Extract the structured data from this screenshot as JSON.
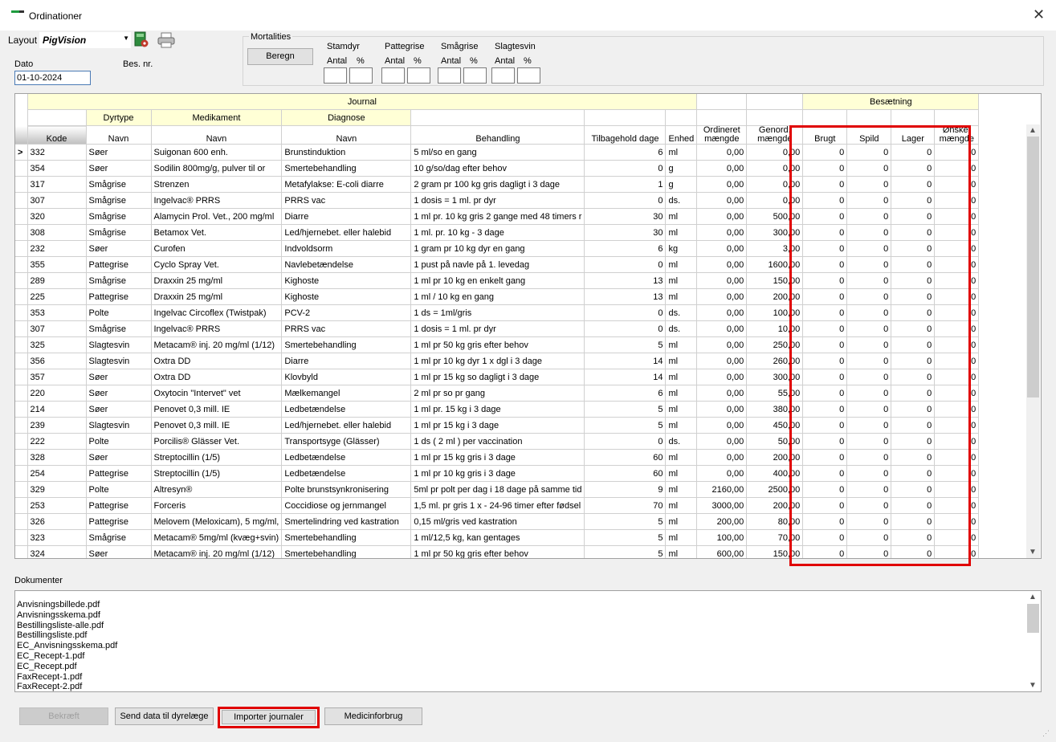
{
  "window": {
    "title": "Ordinationer",
    "close": "✕"
  },
  "layout": {
    "label": "Layout",
    "value": "PigVision"
  },
  "dato": {
    "label": "Dato",
    "value": "01-10-2024"
  },
  "besnr": {
    "label": "Bes. nr."
  },
  "mortalities": {
    "title": "Mortalities",
    "beregn": "Beregn",
    "groups": [
      {
        "name": "Stamdyr",
        "antal": "Antal",
        "pct": "%"
      },
      {
        "name": "Pattegrise",
        "antal": "Antal",
        "pct": "%"
      },
      {
        "name": "Smågrise",
        "antal": "Antal",
        "pct": "%"
      },
      {
        "name": "Slagtesvin",
        "antal": "Antal",
        "pct": "%"
      }
    ]
  },
  "grid": {
    "group_journal": "Journal",
    "group_besaetning": "Besætning",
    "sub_dyrtype": "Dyrtype",
    "sub_medikament": "Medikament",
    "sub_diagnose": "Diagnose",
    "columns": [
      "Kode",
      "Navn",
      "Navn",
      "Navn",
      "Behandling",
      "Tilbagehold dage",
      "Enhed",
      "Ordineret mængde",
      "Genord. mængde",
      "Brugt",
      "Spild",
      "Lager",
      "Ønsket mængde"
    ],
    "selected_marker": ">",
    "rows": [
      [
        "332",
        "Søer",
        "Suigonan 600 enh.",
        "Brunstinduktion",
        "5 ml/so en gang",
        "6",
        "ml",
        "0,00",
        "0,00",
        "0",
        "0",
        "0",
        "0"
      ],
      [
        "354",
        "Søer",
        "Sodilin 800mg/g, pulver til or",
        "Smertebehandling",
        "10 g/so/dag efter behov",
        "0",
        "g",
        "0,00",
        "0,00",
        "0",
        "0",
        "0",
        "0"
      ],
      [
        "317",
        "Smågrise",
        "Strenzen",
        "Metafylakse: E-coli diarre",
        "2 gram pr 100 kg gris dagligt i 3 dage",
        "1",
        "g",
        "0,00",
        "0,00",
        "0",
        "0",
        "0",
        "0"
      ],
      [
        "307",
        "Smågrise",
        "Ingelvac® PRRS",
        "PRRS vac",
        "1 dosis = 1 ml. pr dyr",
        "0",
        "ds.",
        "0,00",
        "0,00",
        "0",
        "0",
        "0",
        "0"
      ],
      [
        "320",
        "Smågrise",
        "Alamycin Prol. Vet., 200 mg/ml",
        "Diarre",
        "1 ml pr. 10 kg gris 2 gange med 48 timers r",
        "30",
        "ml",
        "0,00",
        "500,00",
        "0",
        "0",
        "0",
        "0"
      ],
      [
        "308",
        "Smågrise",
        "Betamox Vet.",
        "Led/hjernebet. eller halebid",
        "1 ml. pr. 10 kg - 3 dage",
        "30",
        "ml",
        "0,00",
        "300,00",
        "0",
        "0",
        "0",
        "0"
      ],
      [
        "232",
        "Søer",
        "Curofen",
        "Indvoldsorm",
        "1 gram pr 10 kg dyr en gang",
        "6",
        "kg",
        "0,00",
        "3,00",
        "0",
        "0",
        "0",
        "0"
      ],
      [
        "355",
        "Pattegrise",
        "Cyclo Spray Vet.",
        "Navlebetændelse",
        "1 pust på navle på 1. levedag",
        "0",
        "ml",
        "0,00",
        "1600,00",
        "0",
        "0",
        "0",
        "0"
      ],
      [
        "289",
        "Smågrise",
        "Draxxin 25 mg/ml",
        "Kighoste",
        "1 ml pr 10 kg en enkelt gang",
        "13",
        "ml",
        "0,00",
        "150,00",
        "0",
        "0",
        "0",
        "0"
      ],
      [
        "225",
        "Pattegrise",
        "Draxxin 25 mg/ml",
        "Kighoste",
        "1 ml / 10 kg en gang",
        "13",
        "ml",
        "0,00",
        "200,00",
        "0",
        "0",
        "0",
        "0"
      ],
      [
        "353",
        "Polte",
        "Ingelvac Circoflex (Twistpak)",
        "PCV-2",
        "1 ds = 1ml/gris",
        "0",
        "ds.",
        "0,00",
        "100,00",
        "0",
        "0",
        "0",
        "0"
      ],
      [
        "307",
        "Smågrise",
        "Ingelvac® PRRS",
        "PRRS vac",
        "1 dosis = 1 ml. pr dyr",
        "0",
        "ds.",
        "0,00",
        "10,00",
        "0",
        "0",
        "0",
        "0"
      ],
      [
        "325",
        "Slagtesvin",
        "Metacam® inj. 20 mg/ml (1/12)",
        "Smertebehandling",
        "1 ml pr 50 kg gris efter behov",
        "5",
        "ml",
        "0,00",
        "250,00",
        "0",
        "0",
        "0",
        "0"
      ],
      [
        "356",
        "Slagtesvin",
        "Oxtra DD",
        "Diarre",
        "1 ml pr 10 kg dyr 1 x dgl i 3 dage",
        "14",
        "ml",
        "0,00",
        "260,00",
        "0",
        "0",
        "0",
        "0"
      ],
      [
        "357",
        "Søer",
        "Oxtra DD",
        "Klovbyld",
        "1 ml pr 15 kg so dagligt i 3 dage",
        "14",
        "ml",
        "0,00",
        "300,00",
        "0",
        "0",
        "0",
        "0"
      ],
      [
        "220",
        "Søer",
        "Oxytocin \"Intervet\" vet",
        "Mælkemangel",
        "2 ml pr so pr gang",
        "6",
        "ml",
        "0,00",
        "55,00",
        "0",
        "0",
        "0",
        "0"
      ],
      [
        "214",
        "Søer",
        "Penovet 0,3 mill. IE",
        "Ledbetændelse",
        "1 ml pr. 15 kg i 3 dage",
        "5",
        "ml",
        "0,00",
        "380,00",
        "0",
        "0",
        "0",
        "0"
      ],
      [
        "239",
        "Slagtesvin",
        "Penovet 0,3 mill. IE",
        "Led/hjernebet. eller halebid",
        "1 ml pr 15 kg i 3 dage",
        "5",
        "ml",
        "0,00",
        "450,00",
        "0",
        "0",
        "0",
        "0"
      ],
      [
        "222",
        "Polte",
        "Porcilis® Glässer Vet.",
        "Transportsyge (Glässer)",
        "1 ds ( 2 ml ) per vaccination",
        "0",
        "ds.",
        "0,00",
        "50,00",
        "0",
        "0",
        "0",
        "0"
      ],
      [
        "328",
        "Søer",
        "Streptocillin (1/5)",
        "Ledbetændelse",
        "1 ml pr 15 kg gris i 3 dage",
        "60",
        "ml",
        "0,00",
        "200,00",
        "0",
        "0",
        "0",
        "0"
      ],
      [
        "254",
        "Pattegrise",
        "Streptocillin (1/5)",
        "Ledbetændelse",
        "1 ml  pr 10 kg gris i 3 dage",
        "60",
        "ml",
        "0,00",
        "400,00",
        "0",
        "0",
        "0",
        "0"
      ],
      [
        "329",
        "Polte",
        "Altresyn®",
        "Polte brunstsynkronisering",
        "5ml pr polt per dag i 18 dage på samme tid",
        "9",
        "ml",
        "2160,00",
        "2500,00",
        "0",
        "0",
        "0",
        "0"
      ],
      [
        "253",
        "Pattegrise",
        "Forceris",
        "Coccidiose og jernmangel",
        "1,5 ml. pr gris 1 x - 24-96 timer efter fødsel",
        "70",
        "ml",
        "3000,00",
        "200,00",
        "0",
        "0",
        "0",
        "0"
      ],
      [
        "326",
        "Pattegrise",
        "Melovem (Meloxicam), 5 mg/ml,",
        "Smertelindring ved kastration",
        "0,15 ml/gris ved kastration",
        "5",
        "ml",
        "200,00",
        "80,00",
        "0",
        "0",
        "0",
        "0"
      ],
      [
        "323",
        "Smågrise",
        "Metacam® 5mg/ml (kvæg+svin)",
        "Smertebehandling",
        "1 ml/12,5 kg, kan gentages",
        "5",
        "ml",
        "100,00",
        "70,00",
        "0",
        "0",
        "0",
        "0"
      ],
      [
        "324",
        "Søer",
        "Metacam® inj. 20 mg/ml (1/12)",
        "Smertebehandling",
        "1 ml pr 50 kg gris efter behov",
        "5",
        "ml",
        "600,00",
        "150,00",
        "0",
        "0",
        "0",
        "0"
      ]
    ]
  },
  "documents": {
    "label": "Dokumenter",
    "items": [
      "Anvisningsbillede.pdf",
      "Anvisningsskema.pdf",
      "Bestillingsliste-alle.pdf",
      "Bestillingsliste.pdf",
      "EC_Anvisningsskema.pdf",
      "EC_Recept-1.pdf",
      "EC_Recept.pdf",
      "FaxRecept-1.pdf",
      "FaxRecept-2.pdf"
    ]
  },
  "buttons": {
    "bekraeft": "Bekræft",
    "send": "Send data til dyrelæge",
    "importer": "Importer journaler",
    "medicinforbrug": "Medicinforbrug"
  },
  "colors": {
    "highlight": "#e00000",
    "header_yellow": "#ffffd6",
    "icon_green": "#1e9b3e"
  }
}
